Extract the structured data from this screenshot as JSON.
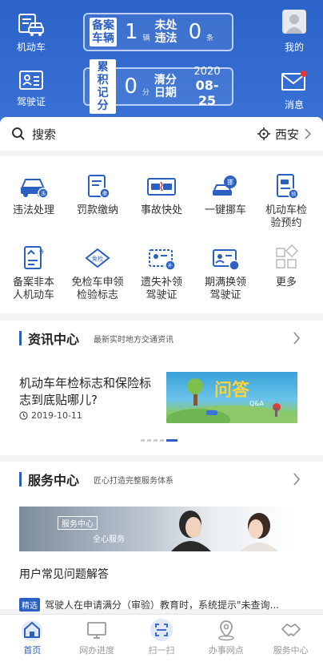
{
  "header": {
    "vehicle_label": "机动车",
    "license_label": "驾驶证",
    "mine_label": "我的",
    "message_label": "消息",
    "record": {
      "label": "备案车辆",
      "count": "1",
      "unit": "辆",
      "unhandled_label": "未处违法",
      "unhandled_count": "0",
      "unhandled_unit": "条"
    },
    "points": {
      "label": "累积记分",
      "value": "0",
      "unit": "分",
      "clear_label": "清分日期",
      "year": "2020",
      "date": "08-25"
    }
  },
  "search": {
    "placeholder": "搜索",
    "city": "西安"
  },
  "services": [
    {
      "label": "违法处理",
      "icon": "car-violation-icon"
    },
    {
      "label": "罚款缴纳",
      "icon": "fine-payment-icon"
    },
    {
      "label": "事故快处",
      "icon": "accident-icon"
    },
    {
      "label": "一键挪车",
      "icon": "move-car-icon"
    },
    {
      "label": "机动车检验预约",
      "icon": "inspection-icon"
    },
    {
      "label": "备案非本人机动车",
      "icon": "register-icon"
    },
    {
      "label": "免检车申领检验标志",
      "icon": "exempt-icon"
    },
    {
      "label": "遗失补领驾驶证",
      "icon": "reissue-license-icon"
    },
    {
      "label": "期满换领驾驶证",
      "icon": "renew-license-icon"
    },
    {
      "label": "更多",
      "icon": "more-icon"
    }
  ],
  "news": {
    "title": "资讯中心",
    "subtitle": "最新实时地方交通资讯",
    "article_title": "机动车年检标志和保险标志到底贴哪儿?",
    "article_date": "2019-10-11",
    "image_text": "问答",
    "image_sub": "Q&A"
  },
  "service_center": {
    "title": "服务中心",
    "subtitle": "匠心打造完整服务体系",
    "banner_badge": "服务中心",
    "banner_text": "全心服务",
    "faq_title": "用户常见问题解答",
    "faq_tag": "精选",
    "faq_text": "驾驶人在申请满分（审验）教育时，系统提示\"未查询..."
  },
  "nav": [
    {
      "label": "首页",
      "icon": "home-icon",
      "active": true
    },
    {
      "label": "网办进度",
      "icon": "monitor-icon",
      "active": false
    },
    {
      "label": "扫一扫",
      "icon": "scan-icon",
      "active": false
    },
    {
      "label": "办事网点",
      "icon": "location-icon",
      "active": false
    },
    {
      "label": "服务中心",
      "icon": "handshake-icon",
      "active": false
    }
  ],
  "colors": {
    "primary": "#2b5fc2",
    "header_bg": "#3a72d6",
    "notification_dot": "#e23a3a"
  }
}
